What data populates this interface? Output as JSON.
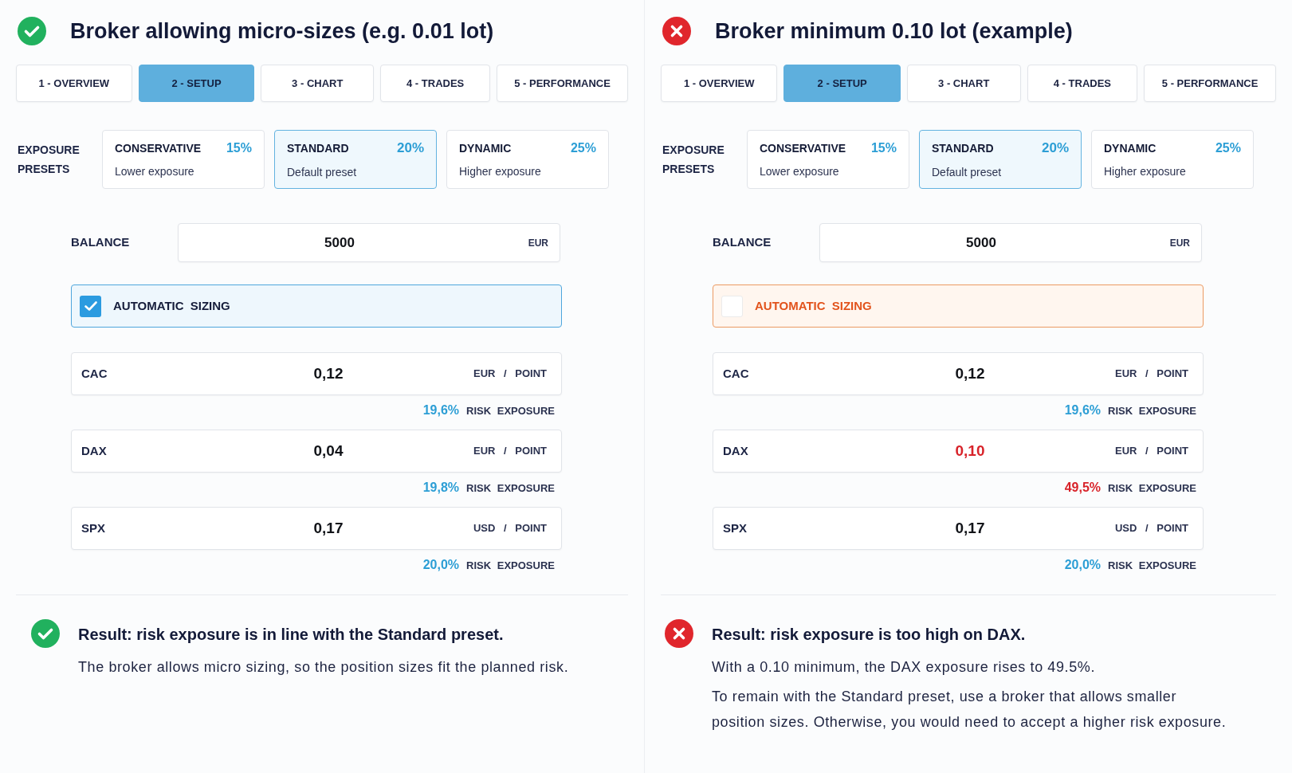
{
  "panels": [
    {
      "passed": true,
      "title": "Broker allowing micro-sizes (e.g. 0.01 lot)",
      "tabs": [
        {
          "label": "1 - OVERVIEW",
          "selected": false
        },
        {
          "label": "2 - SETUP",
          "selected": true
        },
        {
          "label": "3 - CHART",
          "selected": false
        },
        {
          "label": "4 - TRADES",
          "selected": false
        },
        {
          "label": "5 - PERFORMANCE",
          "selected": false
        }
      ],
      "presets": {
        "label": "EXPOSURE PRESETS",
        "items": [
          {
            "name": "CONSERVATIVE",
            "percent": "15%",
            "description": "Lower exposure",
            "selected": false
          },
          {
            "name": "STANDARD",
            "percent": "20%",
            "description": "Default preset",
            "selected": true
          },
          {
            "name": "DYNAMIC",
            "percent": "25%",
            "description": "Higher exposure",
            "selected": false
          }
        ]
      },
      "balance": {
        "label": "BALANCE",
        "value": "5000",
        "currency": "EUR"
      },
      "auto_sizing": {
        "label": "AUTOMATIC SIZING",
        "checked": true
      },
      "assets": [
        {
          "name": "CAC",
          "value": "0,12",
          "unit": "EUR / POINT",
          "risk": "19,6%",
          "risk_label": "RISK EXPOSURE",
          "alert": false
        },
        {
          "name": "DAX",
          "value": "0,04",
          "unit": "EUR / POINT",
          "risk": "19,8%",
          "risk_label": "RISK EXPOSURE",
          "alert": false
        },
        {
          "name": "SPX",
          "value": "0,17",
          "unit": "USD / POINT",
          "risk": "20,0%",
          "risk_label": "RISK EXPOSURE",
          "alert": false
        }
      ],
      "result": {
        "passed": true,
        "title": "Result: risk exposure is in line with the Standard preset.",
        "paragraphs": [
          "The broker allows micro sizing, so the position sizes fit the planned risk."
        ]
      }
    },
    {
      "passed": false,
      "title": "Broker minimum 0.10 lot (example)",
      "tabs": [
        {
          "label": "1 - OVERVIEW",
          "selected": false
        },
        {
          "label": "2 - SETUP",
          "selected": true
        },
        {
          "label": "3 - CHART",
          "selected": false
        },
        {
          "label": "4 - TRADES",
          "selected": false
        },
        {
          "label": "5 - PERFORMANCE",
          "selected": false
        }
      ],
      "presets": {
        "label": "EXPOSURE PRESETS",
        "items": [
          {
            "name": "CONSERVATIVE",
            "percent": "15%",
            "description": "Lower exposure",
            "selected": false
          },
          {
            "name": "STANDARD",
            "percent": "20%",
            "description": "Default preset",
            "selected": true
          },
          {
            "name": "DYNAMIC",
            "percent": "25%",
            "description": "Higher exposure",
            "selected": false
          }
        ]
      },
      "balance": {
        "label": "BALANCE",
        "value": "5000",
        "currency": "EUR"
      },
      "auto_sizing": {
        "label": "AUTOMATIC SIZING",
        "checked": false
      },
      "assets": [
        {
          "name": "CAC",
          "value": "0,12",
          "unit": "EUR / POINT",
          "risk": "19,6%",
          "risk_label": "RISK EXPOSURE",
          "alert": false
        },
        {
          "name": "DAX",
          "value": "0,10",
          "unit": "EUR / POINT",
          "risk": "49,5%",
          "risk_label": "RISK EXPOSURE",
          "alert": true
        },
        {
          "name": "SPX",
          "value": "0,17",
          "unit": "USD / POINT",
          "risk": "20,0%",
          "risk_label": "RISK EXPOSURE",
          "alert": false
        }
      ],
      "result": {
        "passed": false,
        "title": "Result: risk exposure is too high on DAX.",
        "paragraphs": [
          "With a 0.10 minimum, the DAX exposure rises to 49.5%.",
          "To remain with the Standard preset, use a broker that allows smaller position sizes. Otherwise, you would need to accept a higher risk exposure."
        ]
      }
    }
  ]
}
